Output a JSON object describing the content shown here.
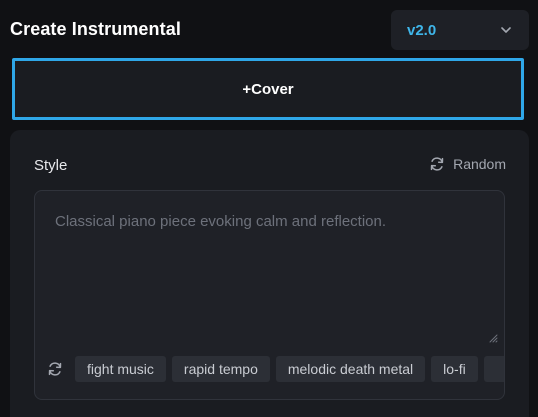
{
  "header": {
    "title": "Create Instrumental",
    "version": {
      "selected": "v2.0"
    }
  },
  "cover_button": {
    "label": "+Cover"
  },
  "style_panel": {
    "label": "Style",
    "random_label": "Random",
    "textarea": {
      "placeholder": "Classical piano piece evoking calm and reflection."
    },
    "tags": [
      "fight music",
      "rapid tempo",
      "melodic death metal",
      "lo-fi",
      ""
    ]
  },
  "colors": {
    "accent": "#2fa7e8",
    "version_text": "#3fb6ea",
    "background": "#101114",
    "panel": "#1a1c21"
  }
}
